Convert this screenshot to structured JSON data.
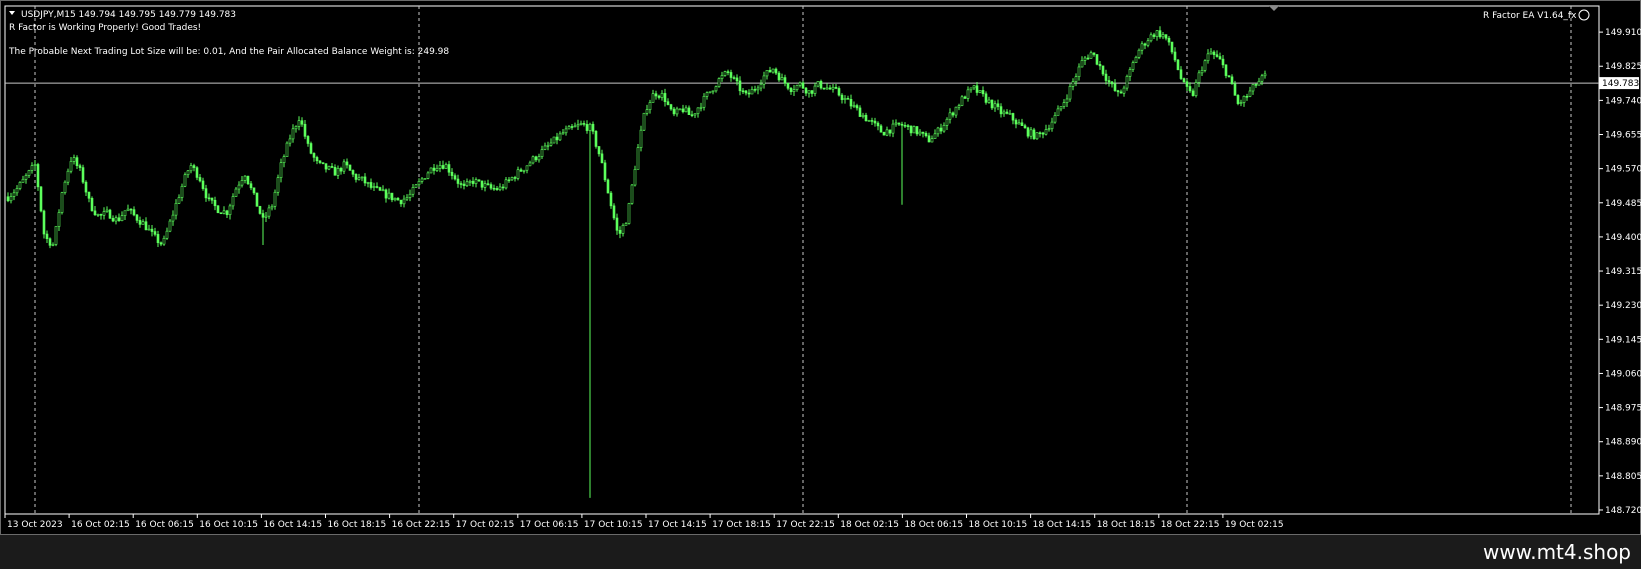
{
  "header": {
    "symbol_info": "USDJPY,M15  149.794 149.795 149.779 149.783",
    "status_line": "R Factor is Working Properly! Good Trades!",
    "lot_info": "The Probable Next Trading Lot Size will be: 0.01, And the Pair Allocated Balance Weight is: 249.98",
    "ea_label": "R Factor EA  V1.64_fx"
  },
  "colors": {
    "background": "#000000",
    "candle": "#5cff5c",
    "axis": "#ffffff",
    "grid": "#c8c8c8"
  },
  "watermark": "www.mt4.shop",
  "chart_data": {
    "type": "candlestick",
    "symbol": "USDJPY",
    "timeframe": "M15",
    "ylim": [
      148.71,
      149.975
    ],
    "y_ticks": [
      "149.910",
      "149.825",
      "149.740",
      "149.655",
      "149.570",
      "149.485",
      "149.400",
      "149.315",
      "149.230",
      "149.145",
      "149.060",
      "148.975",
      "148.890",
      "148.805",
      "148.720"
    ],
    "x_ticks": [
      "13 Oct 2023",
      "16 Oct 02:15",
      "16 Oct 06:15",
      "16 Oct 10:15",
      "16 Oct 14:15",
      "16 Oct 18:15",
      "16 Oct 22:15",
      "17 Oct 02:15",
      "17 Oct 06:15",
      "17 Oct 10:15",
      "17 Oct 14:15",
      "17 Oct 18:15",
      "17 Oct 22:15",
      "18 Oct 02:15",
      "18 Oct 06:15",
      "18 Oct 10:15",
      "18 Oct 14:15",
      "18 Oct 18:15",
      "18 Oct 22:15",
      "19 Oct 02:15"
    ],
    "current_price": "149.783",
    "close_path": [
      149.5,
      149.52,
      149.55,
      149.58,
      149.4,
      149.38,
      149.52,
      149.6,
      149.56,
      149.48,
      149.45,
      149.46,
      149.44,
      149.47,
      149.45,
      149.43,
      149.4,
      149.38,
      149.45,
      149.52,
      149.58,
      149.55,
      149.49,
      149.47,
      149.46,
      149.52,
      149.56,
      149.5,
      149.44,
      149.48,
      149.58,
      149.65,
      149.7,
      149.62,
      149.58,
      149.57,
      149.56,
      149.58,
      149.55,
      149.54,
      149.52,
      149.51,
      149.5,
      149.49,
      149.5,
      149.53,
      149.56,
      149.58,
      149.58,
      149.55,
      149.52,
      149.54,
      149.53,
      149.52,
      149.52,
      149.54,
      149.56,
      149.58,
      149.6,
      149.62,
      149.64,
      149.66,
      149.67,
      149.68,
      149.67,
      149.6,
      149.5,
      149.4,
      149.45,
      149.6,
      149.72,
      149.76,
      149.75,
      149.7,
      149.72,
      149.7,
      149.73,
      149.76,
      149.79,
      149.81,
      149.78,
      149.75,
      149.77,
      149.8,
      149.82,
      149.79,
      149.77,
      149.78,
      149.76,
      149.78,
      149.77,
      149.76,
      149.74,
      149.72,
      149.7,
      149.68,
      149.66,
      149.67,
      149.68,
      149.67,
      149.66,
      149.64,
      149.66,
      149.69,
      149.72,
      149.75,
      149.77,
      149.75,
      149.73,
      149.71,
      149.7,
      149.68,
      149.66,
      149.65,
      149.67,
      149.7,
      149.74,
      149.79,
      149.84,
      149.86,
      149.82,
      149.78,
      149.75,
      149.8,
      149.86,
      149.89,
      149.91,
      149.9,
      149.85,
      149.78,
      149.75,
      149.82,
      149.86,
      149.84,
      149.8,
      149.73,
      149.75,
      149.78,
      149.8
    ],
    "spikes": [
      {
        "time_index": 28,
        "low": 149.38
      },
      {
        "time_index": 64,
        "low": 148.75
      },
      {
        "time_index": 98,
        "low": 149.48
      }
    ]
  }
}
